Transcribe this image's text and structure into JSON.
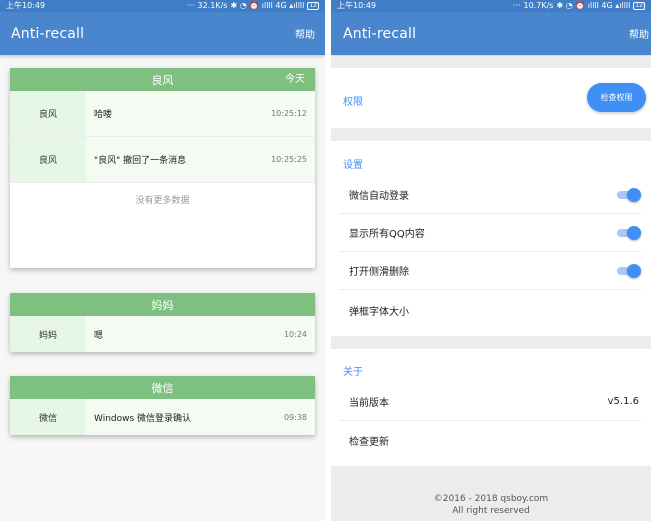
{
  "status_left": {
    "time": "上午10:49",
    "dots": "···",
    "speed": "32.1K/s",
    "icons": "✱ ◔ ⏰ ıllll 4G ▴ıllll",
    "battery": "12"
  },
  "status_right": {
    "time": "上午10:49",
    "dots": "···",
    "speed": "10.7K/s",
    "icons": "✱ ◔ ⏰ ıllll 4G ▴ıllll",
    "battery": "12"
  },
  "left_app": {
    "title": "Anti-recall",
    "help_label": "帮助"
  },
  "right_app": {
    "title": "Anti-recall",
    "help_label": "帮助"
  },
  "cards": [
    {
      "name": "良风",
      "tag": "今天",
      "rows": [
        {
          "who": "良风",
          "text": "哈喽",
          "time": "10:25:12"
        },
        {
          "who": "良风",
          "text": "\"良风\" 撤回了一条消息",
          "time": "10:25:25"
        }
      ],
      "footer": "没有更多数据"
    },
    {
      "name": "妈妈",
      "rows": [
        {
          "who": "妈妈",
          "text": "嗯",
          "time": "10:24"
        }
      ]
    },
    {
      "name": "微信",
      "rows": [
        {
          "who": "微信",
          "text": "Windows 微信登录确认",
          "time": "09:38"
        }
      ]
    }
  ],
  "settings": {
    "permission_label": "权限",
    "permission_button": "检查权限",
    "settings_header": "设置",
    "items": [
      {
        "label": "微信自动登录",
        "on": true
      },
      {
        "label": "显示所有QQ内容",
        "on": true
      },
      {
        "label": "打开侧滑删除",
        "on": true
      },
      {
        "label": "弹框字体大小"
      }
    ],
    "about_header": "关于",
    "version_label": "当前版本",
    "version_value": "v5.1.6",
    "check_update": "检查更新",
    "footer_line1": "©2016 - 2018 qsboy.com",
    "footer_line2": "All right reserved"
  },
  "colors": {
    "primary": "#4a86cd",
    "accent": "#3f8ff5",
    "card_head": "#7ec080",
    "row_bg": "#e6f7e6"
  }
}
